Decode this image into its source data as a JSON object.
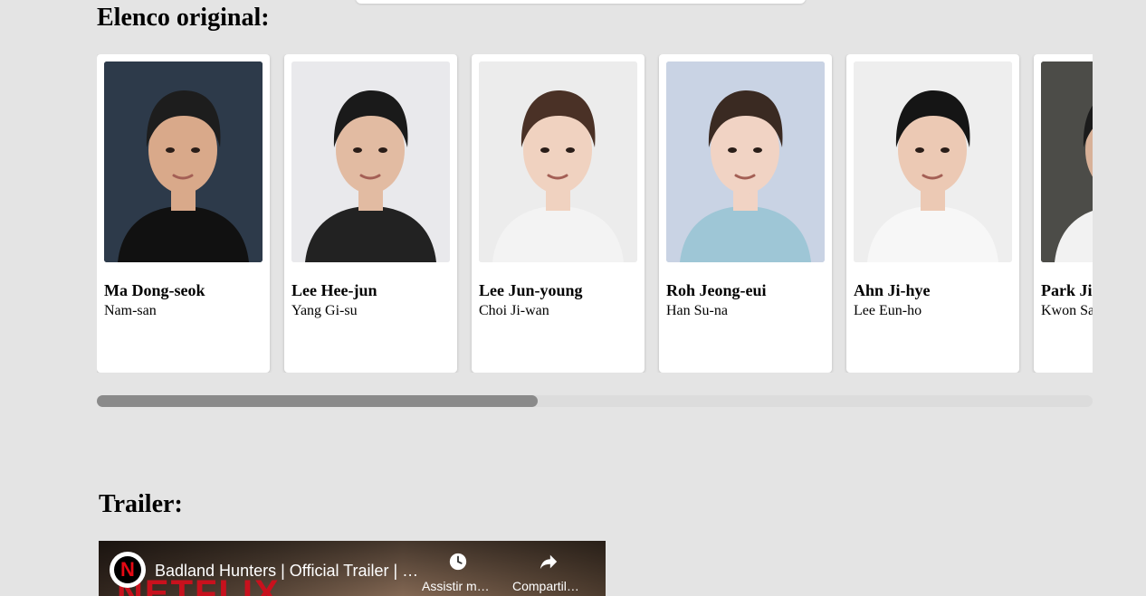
{
  "cast_section": {
    "title": "Elenco original:",
    "members": [
      {
        "actor": "Ma Dong-seok",
        "role": "Nam-san",
        "photo_bg": "#2d3a4a"
      },
      {
        "actor": "Lee Hee-jun",
        "role": "Yang Gi-su",
        "photo_bg": "#e9e9ec"
      },
      {
        "actor": "Lee Jun-young",
        "role": "Choi Ji-wan",
        "photo_bg": "#ececec"
      },
      {
        "actor": "Roh Jeong-eui",
        "role": "Han Su-na",
        "photo_bg": "#c9d3e4"
      },
      {
        "actor": "Ahn Ji-hye",
        "role": "Lee Eun-ho",
        "photo_bg": "#eeeeee"
      },
      {
        "actor": "Park Ji-hwan",
        "role": "Kwon Sang-gu",
        "photo_bg": "#4c4c48"
      }
    ],
    "scroll_position_fraction": 0.443
  },
  "trailer_section": {
    "title": "Trailer:",
    "video": {
      "channel_letter": "N",
      "watermark": "NETFLIX",
      "title": "Badland Hunters | Official Trailer | Netflix",
      "actions": {
        "watch_later_icon": "clock-icon",
        "watch_later_label": "Assistir mais tarde",
        "share_icon": "share-arrow-icon",
        "share_label": "Compartilhar"
      }
    }
  },
  "colors": {
    "page_background": "#e4e4e4",
    "card_background": "#ffffff",
    "scrollbar_track": "#dcdcdc",
    "scrollbar_thumb": "#8a8a8a",
    "netflix_red": "#e50914"
  }
}
